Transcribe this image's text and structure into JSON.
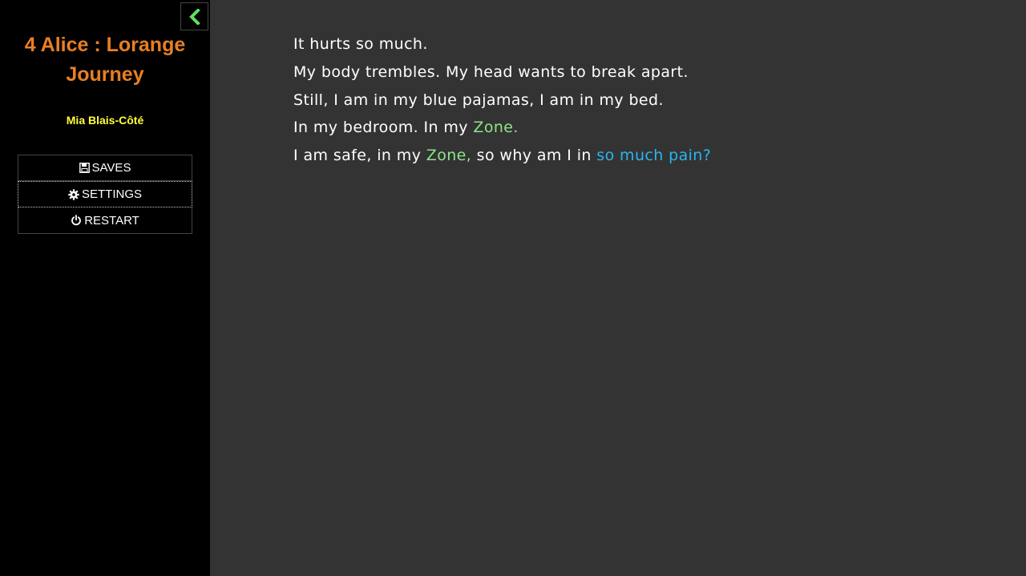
{
  "sidebar": {
    "title": "4 Alice : Lorange Journey",
    "author": "Mia Blais-Côté",
    "menu": [
      {
        "label": "SAVES",
        "icon": "floppy-disk-icon"
      },
      {
        "label": "SETTINGS",
        "icon": "gear-icon"
      },
      {
        "label": "RESTART",
        "icon": "power-icon"
      }
    ],
    "toggle_icon": "chevron-left-icon"
  },
  "passage": {
    "line1": "It hurts so much.",
    "line2": "My body trembles. My head wants to break apart.",
    "line3": "Still, I am in my blue pajamas, I am in my bed.",
    "line4_text": "In my bedroom. In my ",
    "line4_zone": "Zone.",
    "line5_text_a": "I am safe, in my ",
    "line5_zone": "Zone,",
    "line5_text_b": " so why am I in ",
    "line5_pain": "so much pain?"
  },
  "colors": {
    "sidebar_bg": "#000000",
    "main_bg": "#333333",
    "title": "#e87f23",
    "author": "#ffff40",
    "zone": "#8ee48a",
    "pain": "#2ab4f0",
    "toggle_chevron": "#5ee05e"
  }
}
